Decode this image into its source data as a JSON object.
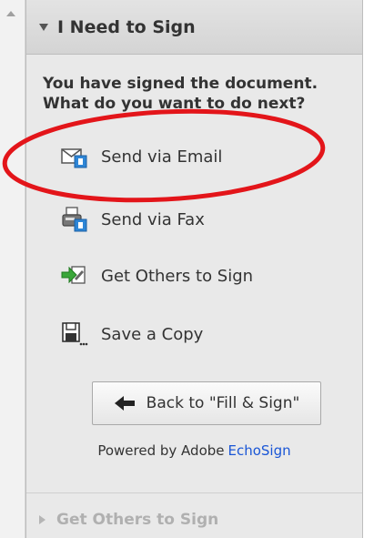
{
  "panel": {
    "section_title": "I Need to Sign",
    "prompt_line1": "You have signed the document.",
    "prompt_line2": "What do you want to do next?"
  },
  "actions": [
    {
      "label": "Send via Email",
      "icon": "email-icon"
    },
    {
      "label": "Send via Fax",
      "icon": "fax-icon"
    },
    {
      "label": "Get Others to Sign",
      "icon": "get-others-to-sign-icon"
    },
    {
      "label": "Save a Copy",
      "icon": "save-icon"
    }
  ],
  "back_button": {
    "label": "Back to \"Fill & Sign\"",
    "icon": "left-arrow-icon"
  },
  "footer": {
    "powered_by": "Powered by Adobe",
    "brand": "EchoSign",
    "brand_color": "#1a56d6"
  },
  "collapsed_section": {
    "title": "Get Others to Sign"
  },
  "colors": {
    "annotation": "#e3151a",
    "panel_bg": "#e9e9e9",
    "text": "#333333"
  }
}
